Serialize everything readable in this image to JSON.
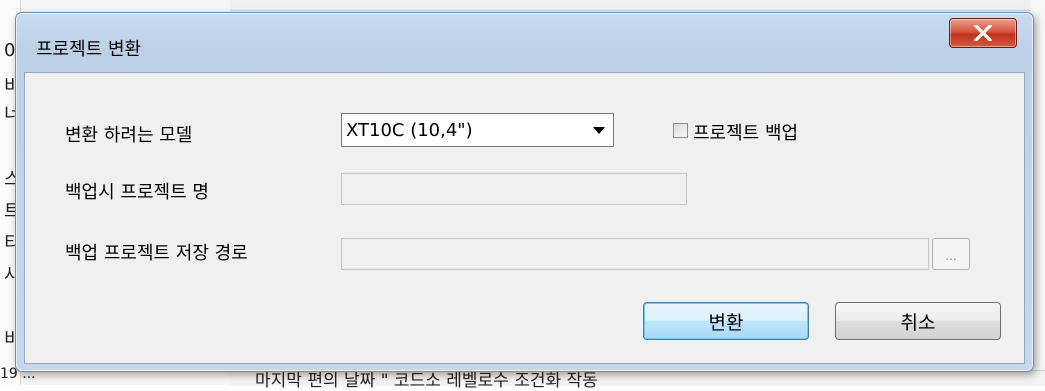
{
  "dialog": {
    "title": "프로젝트 변환",
    "close_icon": "close-icon",
    "model_label": "변환 하려는 모델",
    "model_value": "XT10C (10,4\")",
    "backup_checkbox_label": "프로젝트 백업",
    "backup_checked": false,
    "backup_name_label": "백업시 프로젝트 명",
    "backup_name_value": "",
    "backup_path_label": "백업 프로젝트 저장 경로",
    "backup_path_value": "",
    "browse_label": "...",
    "convert_button": "변환",
    "cancel_button": "취소"
  },
  "background": {
    "left_chars": [
      "0",
      "비",
      "너",
      "스",
      "트",
      "티",
      "사",
      "비"
    ],
    "bottom_left": "19 ...",
    "bottom_text": "마지막 편의 날짜 \"  코드소 레벨로수 조건화 작동"
  }
}
